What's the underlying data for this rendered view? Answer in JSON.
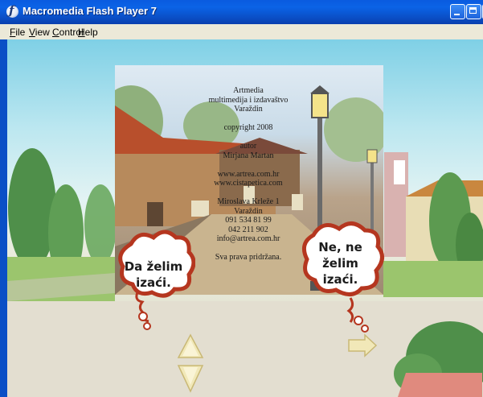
{
  "window": {
    "title": "Macromedia Flash Player 7",
    "controls": {
      "minimize": "minimize-icon",
      "maximize": "maximize-icon",
      "close": "close-icon"
    },
    "accent": "#0a5be0"
  },
  "menu": {
    "items": [
      {
        "label": "File"
      },
      {
        "label": "View"
      },
      {
        "label": "Control"
      },
      {
        "label": "Help"
      }
    ]
  },
  "dialog": {
    "credits": [
      "Artmedia",
      "multimedija i izdavaštvo",
      "Varaždin",
      "",
      "copyright 2008",
      "",
      "autor",
      "Mirjana Martan",
      "",
      "www.artrea.com.hr",
      "www.cistapetica.com",
      "",
      "Miroslava Krleže 1",
      "Varaždin",
      "091 534 81 99",
      "042 211 902",
      "info@artrea.com.hr",
      "",
      "Sva prava pridržana."
    ],
    "yes_cloud": [
      "Da želim",
      "izaći."
    ],
    "no_cloud": [
      "Ne, ne",
      "želim",
      "izaći."
    ]
  },
  "navigation": {
    "up": "arrow-up-icon",
    "down": "arrow-down-icon",
    "right": "arrow-right-icon"
  }
}
